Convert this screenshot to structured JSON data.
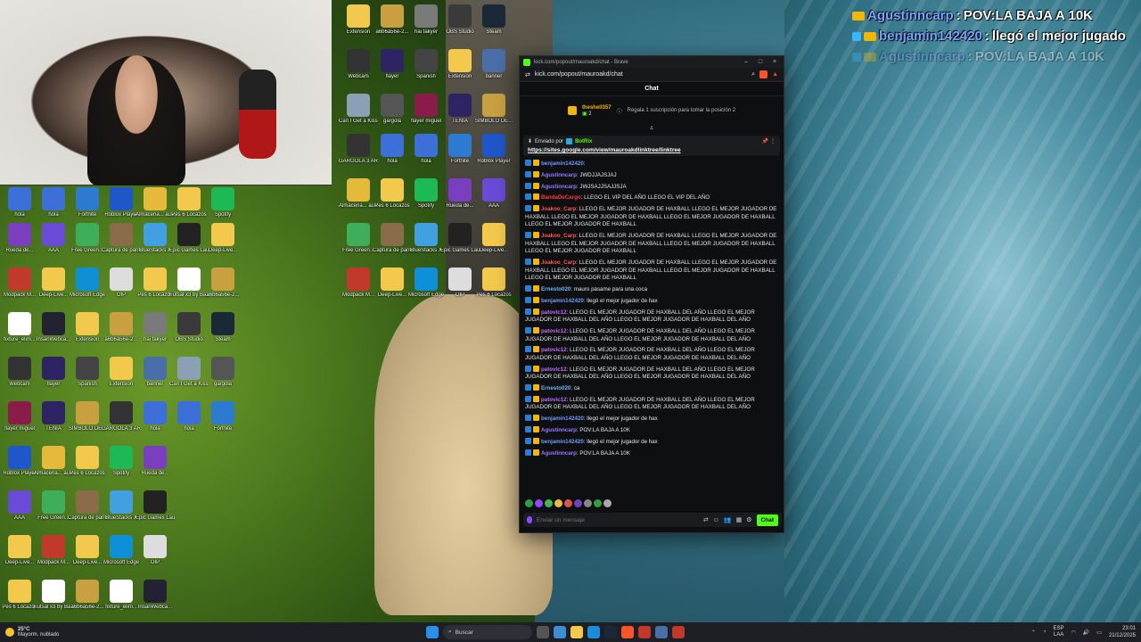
{
  "overlay": {
    "lines": [
      {
        "user": "Agustinncarp",
        "text": "POV:LA BAJA A 10K"
      },
      {
        "user": "benjamin142420",
        "text": "llegó el mejor jugado"
      },
      {
        "user": "Agustinncarp",
        "text": "POV:LA BAJA A 10K"
      }
    ]
  },
  "browser": {
    "title": "kick.com/popout/mauroakd/chat - Brave",
    "url": "kick.com/popout/mauroakd/chat"
  },
  "chat": {
    "header": "Chat",
    "sub_pin": {
      "user": "theshell357",
      "count": "2",
      "description": "Regala 1 suscripción para tomar la posición 2"
    },
    "pinned": {
      "by_label": "Enviado por",
      "by_user": "BotRix",
      "link": "https://sites.google.com/view/mauroakdlinktree/linktree"
    },
    "messages": [
      {
        "user": "benjamin142420",
        "text": "",
        "color": "#6f9bff"
      },
      {
        "user": "Agustinncarp",
        "text": "JWDJJAJSJAJ",
        "color": "#9b7bff"
      },
      {
        "user": "Agustinncarp",
        "text": "JWJSAJJSAJJSJA",
        "color": "#9b7bff"
      },
      {
        "user": "BandaDeCargo",
        "text": "LLEGO EL VIP DEL AÑO  LLEGO EL VIP DEL AÑO",
        "color": "#ff3b3b"
      },
      {
        "user": "Joakoo_Carp",
        "text": "LLEGO EL MEJOR JUGADOR DE HAXBALL  LLEGO EL MEJOR JUGADOR DE HAXBALL  LLEGO EL MEJOR JUGADOR DE HAXBALL  LLEGO EL MEJOR JUGADOR DE HAXBALL  LLEGO EL MEJOR JUGADOR DE HAXBALL",
        "color": "#ff5a5a"
      },
      {
        "user": "Joakoo_Carp",
        "text": "LLEGO EL MEJOR JUGADOR DE HAXBALL  LLEGO EL MEJOR JUGADOR DE HAXBALL  LLEGO EL MEJOR JUGADOR DE HAXBALL  LLEGO EL MEJOR JUGADOR DE HAXBALL  LLEGO EL MEJOR JUGADOR DE HAXBALL",
        "color": "#ff5a5a"
      },
      {
        "user": "Joakoo_Carp",
        "text": "LLEGO EL MEJOR JUGADOR DE HAXBALL  LLEGO EL MEJOR JUGADOR DE HAXBALL  LLEGO EL MEJOR JUGADOR DE HAXBALL  LLEGO EL MEJOR JUGADOR DE HAXBALL  LLEGO EL MEJOR JUGADOR DE HAXBALL",
        "color": "#ff5a5a"
      },
      {
        "user": "Ernesto020",
        "text": "mauro pasame para una coca",
        "color": "#6fb6ff"
      },
      {
        "user": "benjamin142420",
        "text": "llegó el mejor jugador de hax",
        "color": "#6f9bff"
      },
      {
        "user": "patovic12",
        "text": "LLEGO EL MEJOR JUGADOR DE HAXBALL DEL AÑO  LLEGO EL MEJOR JUGADOR DE HAXBALL DEL AÑO  LLEGO EL MEJOR JUGADOR DE HAXBALL DEL AÑO",
        "color": "#c56bff"
      },
      {
        "user": "patovic12",
        "text": "LLEGO EL MEJOR JUGADOR DE HAXBALL DEL AÑO  LLEGO EL MEJOR JUGADOR DE HAXBALL DEL AÑO  LLEGO EL MEJOR JUGADOR DE HAXBALL DEL AÑO",
        "color": "#c56bff"
      },
      {
        "user": "patovic12",
        "text": "LLEGO EL MEJOR JUGADOR DE HAXBALL DEL AÑO  LLEGO EL MEJOR JUGADOR DE HAXBALL DEL AÑO  LLEGO EL MEJOR JUGADOR DE HAXBALL DEL AÑO",
        "color": "#c56bff"
      },
      {
        "user": "patovic12",
        "text": "LLEGO EL MEJOR JUGADOR DE HAXBALL DEL AÑO  LLEGO EL MEJOR JUGADOR DE HAXBALL DEL AÑO  LLEGO EL MEJOR JUGADOR DE HAXBALL DEL AÑO",
        "color": "#c56bff"
      },
      {
        "user": "Ernesto020",
        "text": "ca",
        "color": "#6fb6ff"
      },
      {
        "user": "patovic12",
        "text": "LLEGO EL MEJOR JUGADOR DE HAXBALL DEL AÑO  LLEGO EL MEJOR JUGADOR DE HAXBALL DEL AÑO  LLEGO EL MEJOR JUGADOR DE HAXBALL DEL AÑO",
        "color": "#c56bff"
      },
      {
        "user": "benjamin142420",
        "text": "llegó el mejor jugador de hax",
        "color": "#6f9bff"
      },
      {
        "user": "Agustinncarp",
        "text": "POV:LA BAJA A 10K",
        "color": "#9b7bff"
      },
      {
        "user": "benjamin142420",
        "text": "llegó el mejor jugador de hax",
        "color": "#6f9bff"
      },
      {
        "user": "Agustinncarp",
        "text": "POV:LA BAJA A 10K",
        "color": "#9b7bff"
      }
    ],
    "input_placeholder": "Enviar un mensaje",
    "send_label": "Chat"
  },
  "desktop_icons": [
    {
      "label": "hola",
      "color": "#3d6fd8"
    },
    {
      "label": "hola",
      "color": "#3d6fd8"
    },
    {
      "label": "Fortnite",
      "color": "#2c7bd1"
    },
    {
      "label": "Roblox Player",
      "color": "#1f56c9"
    },
    {
      "label": "Almacena... automatic...",
      "color": "#e5b93a"
    },
    {
      "label": "Pes 6 Locazos",
      "color": "#f2c94c"
    },
    {
      "label": "Spotify",
      "color": "#1db954"
    },
    {
      "label": "Rueda de...",
      "color": "#7a3fbf"
    },
    {
      "label": "AAA",
      "color": "#6a4bd8"
    },
    {
      "label": "Free Green...",
      "color": "#3fae5b"
    },
    {
      "label": "Captura de pantalla...",
      "color": "#8a6b4a"
    },
    {
      "label": "BlueStacks X",
      "color": "#40a0e0"
    },
    {
      "label": "Epic Games Launcher",
      "color": "#222"
    },
    {
      "label": "Deep-Live...",
      "color": "#f2c94c"
    },
    {
      "label": "Modpack M...",
      "color": "#c0392b"
    },
    {
      "label": "Deep-Live...",
      "color": "#f2c94c"
    },
    {
      "label": "Microsoft Edge",
      "color": "#0f8fd8"
    },
    {
      "label": "OIP",
      "color": "#ddd"
    },
    {
      "label": "Pes 6 Locazos",
      "color": "#f2c94c"
    },
    {
      "label": "Futsal x3 by Bazinga fro...",
      "color": "#fff"
    },
    {
      "label": "a6b6a56e-2...",
      "color": "#c8a040"
    },
    {
      "label": "fixture_elim...",
      "color": "#fff"
    },
    {
      "label": "InsanWebca...",
      "color": "#223"
    },
    {
      "label": "Extension",
      "color": "#f2c94c"
    },
    {
      "label": "a6b6a56e-2...",
      "color": "#c8a040"
    },
    {
      "label": "hai fakyer",
      "color": "#7a7a7a"
    },
    {
      "label": "OBS Studio",
      "color": "#3a3a3a"
    },
    {
      "label": "Steam",
      "color": "#1b2838"
    },
    {
      "label": "Webcam",
      "color": "#333"
    },
    {
      "label": "flayer",
      "color": "#2e2463"
    },
    {
      "label": "Spanish",
      "color": "#444"
    },
    {
      "label": "Extension",
      "color": "#f2c94c"
    },
    {
      "label": "banner",
      "color": "#4a6ea8"
    },
    {
      "label": "Can I Get a Kiss Mauroo",
      "color": "#8ba0b4"
    },
    {
      "label": "gargola",
      "color": "#555"
    },
    {
      "label": "flayer miguel",
      "color": "#8a1c4a"
    },
    {
      "label": "TENIA",
      "color": "#2e2463"
    },
    {
      "label": "SIMBOLO DE...",
      "color": "#c8a040"
    },
    {
      "label": "GARGOLA 3 ARRAYGS",
      "color": "#333"
    }
  ],
  "taskbar": {
    "weather_temp": "25°C",
    "weather_desc": "Mayorm. nublado",
    "search_placeholder": "Buscar",
    "lang_top": "ESP",
    "lang_bottom": "LAA",
    "time": "23:01",
    "date": "21/12/2025"
  }
}
